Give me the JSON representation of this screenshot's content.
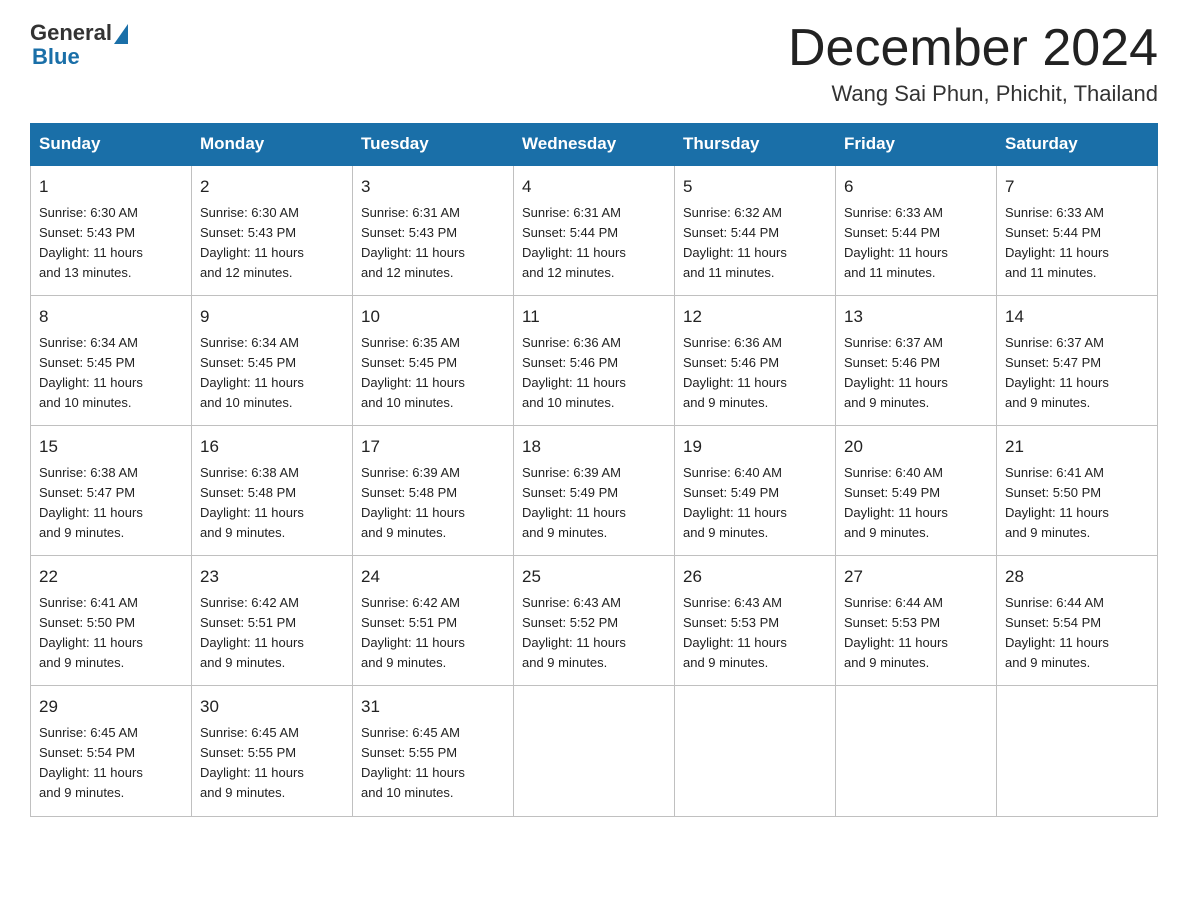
{
  "logo": {
    "general": "General",
    "blue": "Blue"
  },
  "title": "December 2024",
  "location": "Wang Sai Phun, Phichit, Thailand",
  "days_of_week": [
    "Sunday",
    "Monday",
    "Tuesday",
    "Wednesday",
    "Thursday",
    "Friday",
    "Saturday"
  ],
  "weeks": [
    [
      {
        "day": "1",
        "sunrise": "6:30 AM",
        "sunset": "5:43 PM",
        "daylight": "11 hours and 13 minutes."
      },
      {
        "day": "2",
        "sunrise": "6:30 AM",
        "sunset": "5:43 PM",
        "daylight": "11 hours and 12 minutes."
      },
      {
        "day": "3",
        "sunrise": "6:31 AM",
        "sunset": "5:43 PM",
        "daylight": "11 hours and 12 minutes."
      },
      {
        "day": "4",
        "sunrise": "6:31 AM",
        "sunset": "5:44 PM",
        "daylight": "11 hours and 12 minutes."
      },
      {
        "day": "5",
        "sunrise": "6:32 AM",
        "sunset": "5:44 PM",
        "daylight": "11 hours and 11 minutes."
      },
      {
        "day": "6",
        "sunrise": "6:33 AM",
        "sunset": "5:44 PM",
        "daylight": "11 hours and 11 minutes."
      },
      {
        "day": "7",
        "sunrise": "6:33 AM",
        "sunset": "5:44 PM",
        "daylight": "11 hours and 11 minutes."
      }
    ],
    [
      {
        "day": "8",
        "sunrise": "6:34 AM",
        "sunset": "5:45 PM",
        "daylight": "11 hours and 10 minutes."
      },
      {
        "day": "9",
        "sunrise": "6:34 AM",
        "sunset": "5:45 PM",
        "daylight": "11 hours and 10 minutes."
      },
      {
        "day": "10",
        "sunrise": "6:35 AM",
        "sunset": "5:45 PM",
        "daylight": "11 hours and 10 minutes."
      },
      {
        "day": "11",
        "sunrise": "6:36 AM",
        "sunset": "5:46 PM",
        "daylight": "11 hours and 10 minutes."
      },
      {
        "day": "12",
        "sunrise": "6:36 AM",
        "sunset": "5:46 PM",
        "daylight": "11 hours and 9 minutes."
      },
      {
        "day": "13",
        "sunrise": "6:37 AM",
        "sunset": "5:46 PM",
        "daylight": "11 hours and 9 minutes."
      },
      {
        "day": "14",
        "sunrise": "6:37 AM",
        "sunset": "5:47 PM",
        "daylight": "11 hours and 9 minutes."
      }
    ],
    [
      {
        "day": "15",
        "sunrise": "6:38 AM",
        "sunset": "5:47 PM",
        "daylight": "11 hours and 9 minutes."
      },
      {
        "day": "16",
        "sunrise": "6:38 AM",
        "sunset": "5:48 PM",
        "daylight": "11 hours and 9 minutes."
      },
      {
        "day": "17",
        "sunrise": "6:39 AM",
        "sunset": "5:48 PM",
        "daylight": "11 hours and 9 minutes."
      },
      {
        "day": "18",
        "sunrise": "6:39 AM",
        "sunset": "5:49 PM",
        "daylight": "11 hours and 9 minutes."
      },
      {
        "day": "19",
        "sunrise": "6:40 AM",
        "sunset": "5:49 PM",
        "daylight": "11 hours and 9 minutes."
      },
      {
        "day": "20",
        "sunrise": "6:40 AM",
        "sunset": "5:49 PM",
        "daylight": "11 hours and 9 minutes."
      },
      {
        "day": "21",
        "sunrise": "6:41 AM",
        "sunset": "5:50 PM",
        "daylight": "11 hours and 9 minutes."
      }
    ],
    [
      {
        "day": "22",
        "sunrise": "6:41 AM",
        "sunset": "5:50 PM",
        "daylight": "11 hours and 9 minutes."
      },
      {
        "day": "23",
        "sunrise": "6:42 AM",
        "sunset": "5:51 PM",
        "daylight": "11 hours and 9 minutes."
      },
      {
        "day": "24",
        "sunrise": "6:42 AM",
        "sunset": "5:51 PM",
        "daylight": "11 hours and 9 minutes."
      },
      {
        "day": "25",
        "sunrise": "6:43 AM",
        "sunset": "5:52 PM",
        "daylight": "11 hours and 9 minutes."
      },
      {
        "day": "26",
        "sunrise": "6:43 AM",
        "sunset": "5:53 PM",
        "daylight": "11 hours and 9 minutes."
      },
      {
        "day": "27",
        "sunrise": "6:44 AM",
        "sunset": "5:53 PM",
        "daylight": "11 hours and 9 minutes."
      },
      {
        "day": "28",
        "sunrise": "6:44 AM",
        "sunset": "5:54 PM",
        "daylight": "11 hours and 9 minutes."
      }
    ],
    [
      {
        "day": "29",
        "sunrise": "6:45 AM",
        "sunset": "5:54 PM",
        "daylight": "11 hours and 9 minutes."
      },
      {
        "day": "30",
        "sunrise": "6:45 AM",
        "sunset": "5:55 PM",
        "daylight": "11 hours and 9 minutes."
      },
      {
        "day": "31",
        "sunrise": "6:45 AM",
        "sunset": "5:55 PM",
        "daylight": "11 hours and 10 minutes."
      },
      null,
      null,
      null,
      null
    ]
  ],
  "labels": {
    "sunrise": "Sunrise:",
    "sunset": "Sunset:",
    "daylight": "Daylight:"
  }
}
